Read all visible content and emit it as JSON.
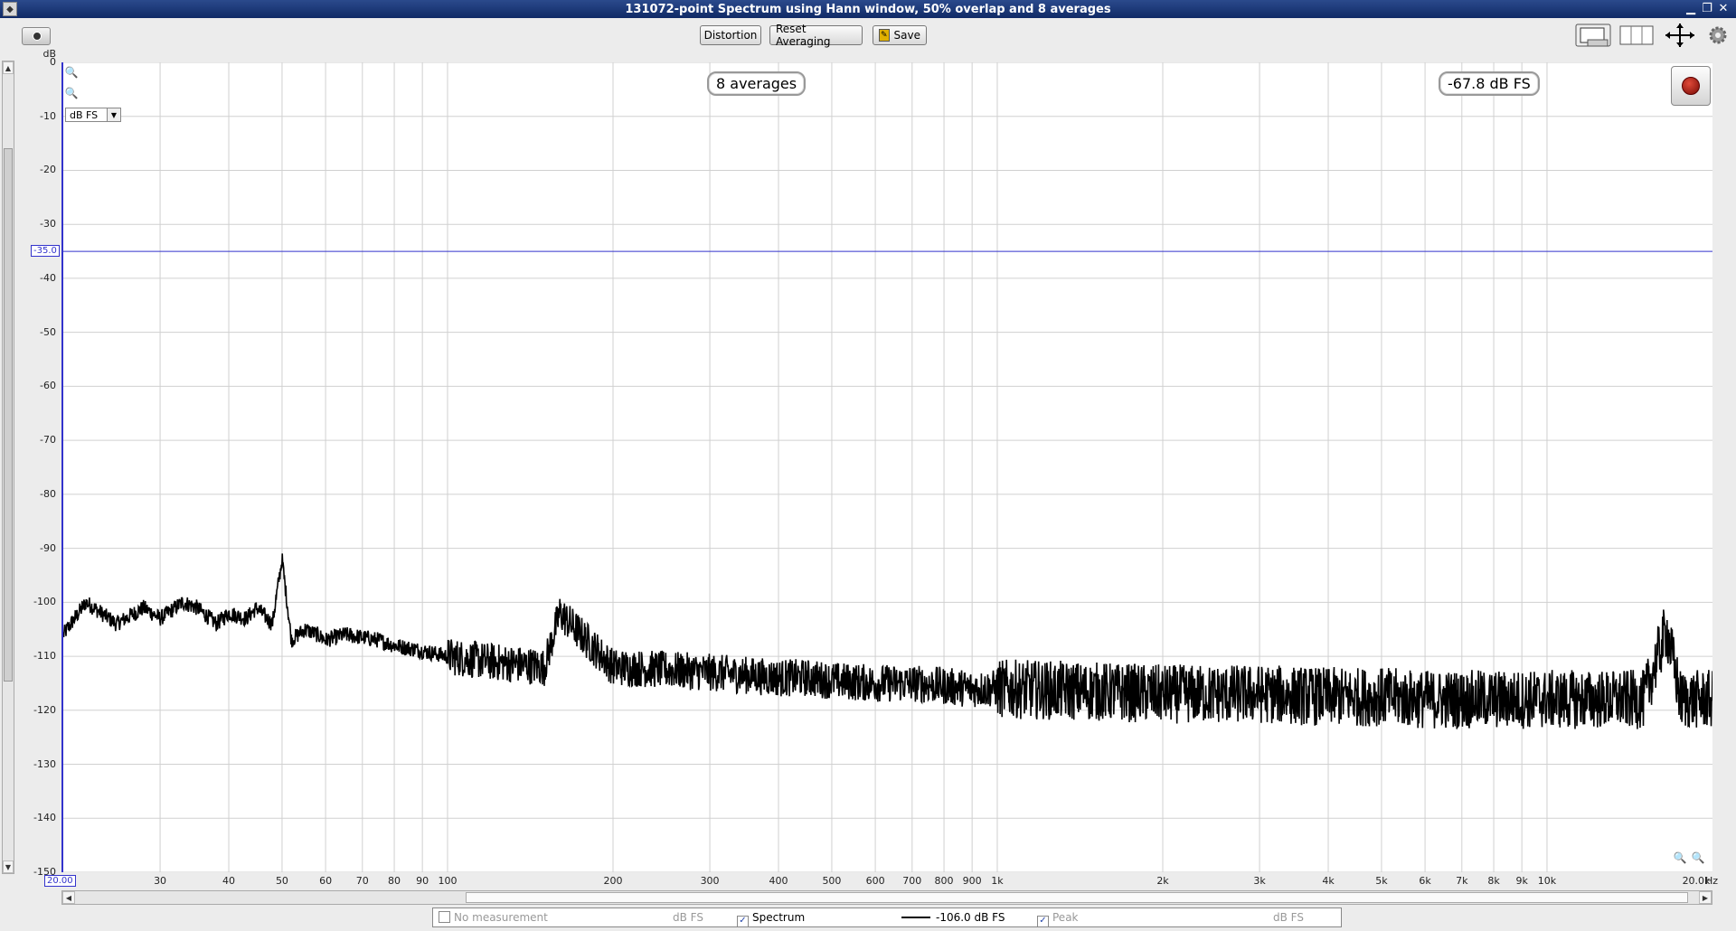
{
  "window": {
    "title": "131072-point Spectrum using Hann window, 50% overlap and 8 averages"
  },
  "toolbar": {
    "distortion_label": "Distortion",
    "reset_label": "Reset Averaging",
    "save_label": "Save"
  },
  "plot": {
    "y_unit": "dB",
    "x_unit": "Hz",
    "unit_selector": "dB FS",
    "averages_badge": "8 averages",
    "level_badge": "-67.8 dB FS",
    "cursor_y_label": "-35.0",
    "cursor_x_label": "20.00",
    "y_ticks": [
      "0",
      "-10",
      "-20",
      "-30",
      "-40",
      "-50",
      "-60",
      "-70",
      "-80",
      "-90",
      "-100",
      "-110",
      "-120",
      "-130",
      "-140",
      "-150"
    ],
    "x_ticks": [
      {
        "f": 30,
        "label": "30"
      },
      {
        "f": 40,
        "label": "40"
      },
      {
        "f": 50,
        "label": "50"
      },
      {
        "f": 60,
        "label": "60"
      },
      {
        "f": 70,
        "label": "70"
      },
      {
        "f": 80,
        "label": "80"
      },
      {
        "f": 90,
        "label": "90"
      },
      {
        "f": 100,
        "label": "100"
      },
      {
        "f": 200,
        "label": "200"
      },
      {
        "f": 300,
        "label": "300"
      },
      {
        "f": 400,
        "label": "400"
      },
      {
        "f": 500,
        "label": "500"
      },
      {
        "f": 600,
        "label": "600"
      },
      {
        "f": 700,
        "label": "700"
      },
      {
        "f": 800,
        "label": "800"
      },
      {
        "f": 900,
        "label": "900"
      },
      {
        "f": 1000,
        "label": "1k"
      },
      {
        "f": 2000,
        "label": "2k"
      },
      {
        "f": 3000,
        "label": "3k"
      },
      {
        "f": 4000,
        "label": "4k"
      },
      {
        "f": 5000,
        "label": "5k"
      },
      {
        "f": 6000,
        "label": "6k"
      },
      {
        "f": 7000,
        "label": "7k"
      },
      {
        "f": 8000,
        "label": "8k"
      },
      {
        "f": 9000,
        "label": "9k"
      },
      {
        "f": 10000,
        "label": "10k"
      },
      {
        "f": 20000,
        "label": "20.0k"
      }
    ]
  },
  "legend": {
    "no_measurement_label": "No measurement",
    "no_measurement_unit": "dB FS",
    "spectrum_label": "Spectrum",
    "spectrum_value": "-106.0 dB FS",
    "peak_label": "Peak",
    "peak_unit": "dB FS"
  },
  "chart_data": {
    "type": "line",
    "title": "",
    "xlabel": "Hz",
    "ylabel": "dB",
    "xscale": "log",
    "xlim": [
      20,
      20000
    ],
    "ylim": [
      -150,
      0
    ],
    "grid": true,
    "cursor_level_db": -35.0,
    "series": [
      {
        "color": "#000000",
        "x": [
          20,
          22,
          25,
          28,
          30,
          33,
          35,
          38,
          40,
          43,
          45,
          48,
          50,
          52,
          55,
          58,
          60,
          65,
          70,
          75,
          80,
          85,
          90,
          100,
          120,
          150,
          160,
          200,
          250,
          300,
          350,
          400,
          450,
          500,
          600,
          700,
          800,
          900,
          1000,
          1500,
          2000,
          3000,
          4000,
          5000,
          6000,
          7000,
          8000,
          10000,
          12000,
          15000,
          16500,
          17500,
          18000,
          20000
        ],
        "y": [
          -106,
          -100,
          -104,
          -101,
          -103,
          -100,
          -101,
          -104,
          -102,
          -103,
          -101,
          -104,
          -92,
          -107,
          -105,
          -106,
          -107,
          -106,
          -106.5,
          -107,
          -108,
          -108.5,
          -109,
          -110,
          -111,
          -112,
          -102,
          -112,
          -112.5,
          -113,
          -113.5,
          -114,
          -114,
          -114.5,
          -115,
          -115,
          -115.5,
          -116,
          -116,
          -116.5,
          -117,
          -117,
          -117.5,
          -117.5,
          -118,
          -118,
          -118,
          -118,
          -118,
          -118,
          -105,
          -118,
          -118,
          -118
        ]
      }
    ]
  }
}
